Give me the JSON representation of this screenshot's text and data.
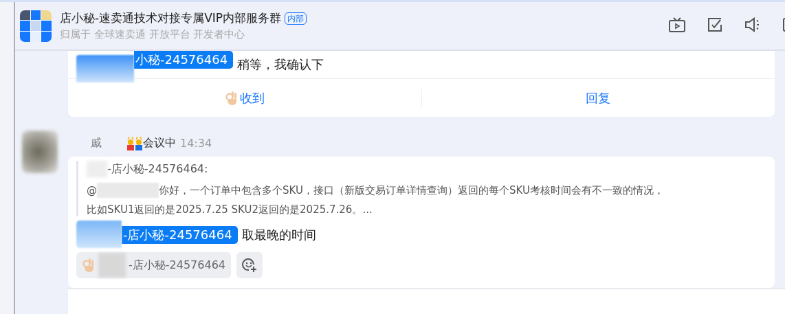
{
  "header": {
    "title": "店小秘-速卖通技术对接专属VIP内部服务群",
    "badge": "内部",
    "subtitle": "归属于 全球速卖通 开放平台 开发者中心"
  },
  "first_message": {
    "mention": "小秘-24576464",
    "text": "稍等，我确认下",
    "actions": [
      "收到",
      "回复"
    ]
  },
  "second_message": {
    "sender": "戚",
    "status": "会议中",
    "time": "14:34",
    "quote": {
      "author": "-店小秘-24576464:",
      "at": "@",
      "line1": "你好，一个订单中包含多个SKU，接口（新版交易订单详情查询）返回的每个SKU考核时间会有不一致的情况，",
      "line2": "比如SKU1返回的是2025.7.25  SKU2返回的是2025.7.26。..."
    },
    "mention": "-店小秘-24576464",
    "text": "取最晚的时间",
    "reaction": {
      "who": "-店小秘-24576464"
    }
  }
}
